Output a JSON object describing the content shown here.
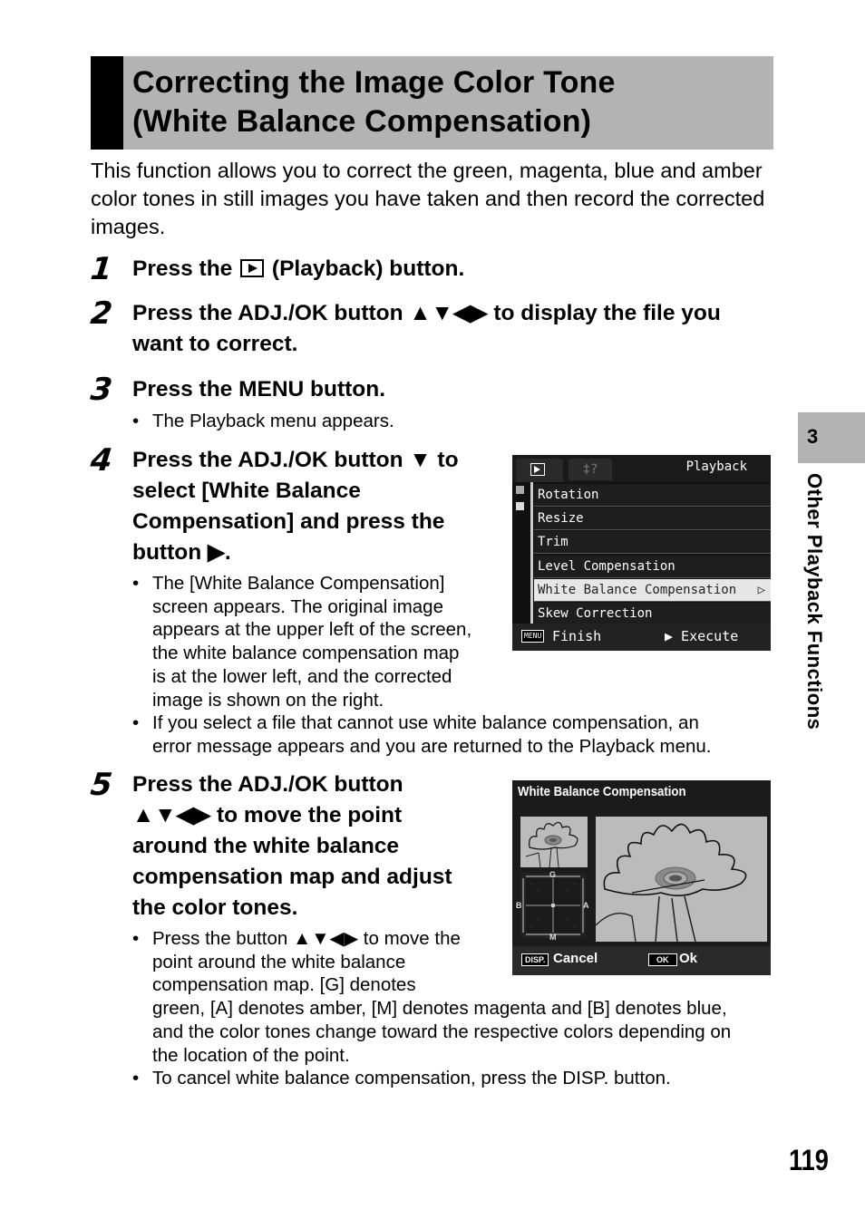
{
  "title": {
    "line1": "Correcting the Image Color Tone",
    "line2": "(White Balance Compensation)"
  },
  "intro": "This function allows you to correct the green, magenta, blue and amber color tones in still images you have taken and then record the corrected images.",
  "steps": [
    {
      "num": "1",
      "before": "Press the ",
      "icon": "playback-icon",
      "after": " (Playback) button."
    },
    {
      "num": "2",
      "line1": "Press the ADJ./OK button ▲▼◀▶ to display the file you",
      "line2": "want to correct."
    },
    {
      "num": "3",
      "text": "Press the MENU button.",
      "bullets": [
        "The Playback menu appears."
      ]
    },
    {
      "num": "4",
      "lines": [
        "Press the ADJ./OK button ▼ to",
        "select [White Balance",
        "Compensation] and press the",
        "button ▶."
      ],
      "bullets": [
        [
          "The [White Balance Compensation]",
          "screen appears. The original image",
          "appears at the upper left of the screen,",
          "the white balance compensation map",
          "is at the lower left, and the corrected",
          "image is shown on the right."
        ],
        [
          "If you select a file that cannot use white balance compensation, an",
          "error message appears and you are returned to the Playback menu."
        ]
      ]
    },
    {
      "num": "5",
      "lines": [
        "Press the ADJ./OK button",
        "▲▼◀▶ to move the point",
        "around the white balance",
        "compensation map and adjust",
        "the color tones."
      ],
      "bullets": [
        [
          "Press the button ▲▼◀▶ to move the",
          "point around the white balance",
          "compensation map. [G] denotes",
          "green, [A] denotes amber, [M] denotes magenta and [B] denotes blue,",
          "and the color tones change toward the respective colors depending on",
          "the location of the point."
        ],
        [
          "To cancel white balance compensation, press the DISP. button."
        ]
      ]
    }
  ],
  "side_tab": {
    "number": "3",
    "label": "Other Playback Functions"
  },
  "page_number": "119",
  "screen1": {
    "menu_name": "Playback",
    "settings_tab_glyph": "‡?",
    "items": [
      "Rotation",
      "Resize",
      "Trim",
      "Level Compensation",
      "White Balance Compensation",
      "Skew Correction"
    ],
    "selected_index": 4,
    "selected_arrow": "▷",
    "menu_key": "MENU",
    "finish_label": "Finish",
    "execute_label": "▶ Execute"
  },
  "screen2": {
    "title": "White Balance Compensation",
    "map_labels": {
      "top": "G",
      "bottom": "M",
      "left": "B",
      "right": "A"
    },
    "disp_key": "DISP.",
    "cancel_label": "Cancel",
    "ok_key": "OK",
    "ok_label": "Ok"
  }
}
